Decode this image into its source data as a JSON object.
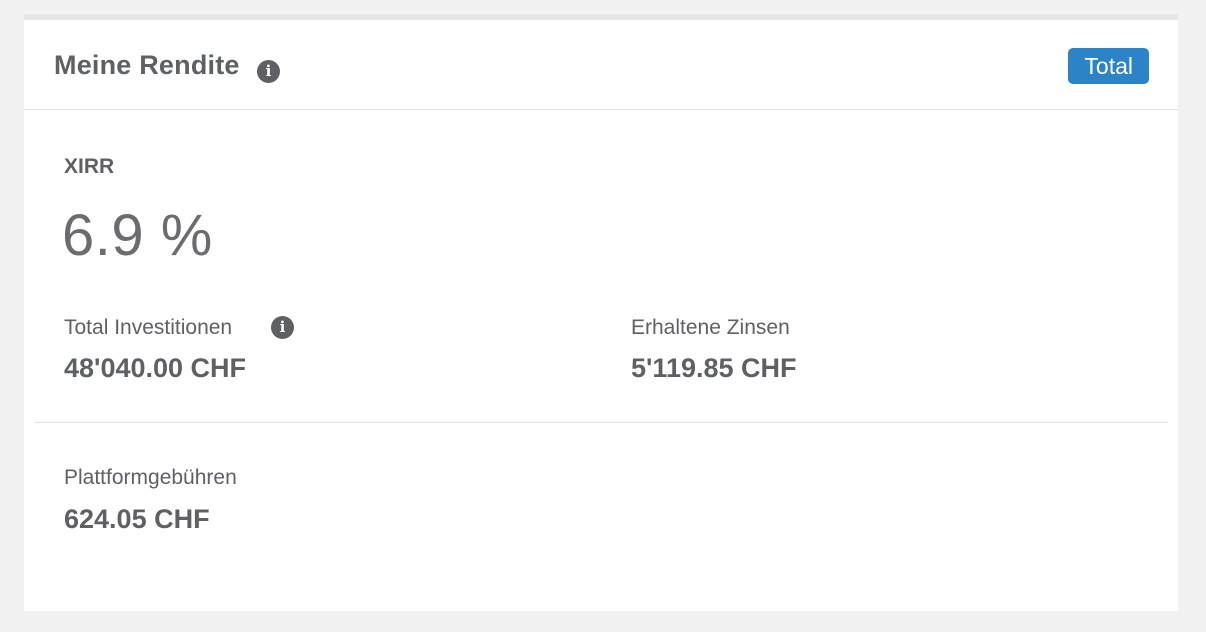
{
  "header": {
    "title": "Meine Rendite",
    "badge": "Total"
  },
  "xirr": {
    "label": "XIRR",
    "value": "6.9 %"
  },
  "investments": {
    "label": "Total Investitionen",
    "value": "48'040.00 CHF"
  },
  "interest": {
    "label": "Erhaltene Zinsen",
    "value": "5'119.85 CHF"
  },
  "fees": {
    "label": "Plattformgebühren",
    "value": "624.05 CHF"
  },
  "icons": {
    "info": "info-icon"
  },
  "colors": {
    "accent": "#2a84c6",
    "text": "#5f6063",
    "background": "#f1f1f2"
  }
}
